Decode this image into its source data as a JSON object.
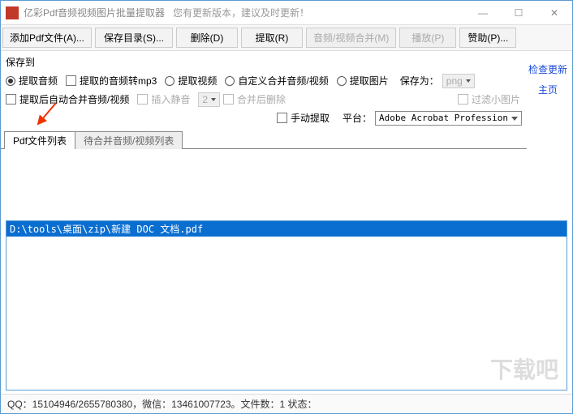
{
  "title": "亿彩Pdf音频视频图片批量提取器",
  "title_sub": "您有更新版本，建议及时更新！",
  "win": {
    "min": "—",
    "max": "☐",
    "close": "✕"
  },
  "toolbar": {
    "add": "添加Pdf文件(A)...",
    "save": "保存目录(S)...",
    "del": "删除(D)",
    "extract": "提取(R)",
    "merge": "音频/视频合并(M)",
    "play": "播放(P)",
    "sponsor": "赞助(P)..."
  },
  "opts": {
    "save_to": "保存到",
    "r_audio": "提取音频",
    "c_mp3": "提取的音频转mp3",
    "r_video": "提取视频",
    "r_custom": "自定义合并音频/视频",
    "r_image": "提取图片",
    "saveas": "保存为：",
    "saveas_val": "png",
    "c_automerge": "提取后自动合并音频/视频",
    "c_silence": "插入静音",
    "silence_val": "2",
    "c_delafter": "合并后删除",
    "c_manual": "手动提取",
    "platform": "平台：",
    "platform_val": "Adobe Acrobat Profession",
    "c_filtersmall": "过滤小图片"
  },
  "links": {
    "update": "检查更新",
    "home": "主页"
  },
  "tabs": {
    "t1": "Pdf文件列表",
    "t2": "待合并音频/视频列表"
  },
  "list": {
    "item0": "D:\\tools\\桌面\\zip\\新建 DOC 文档.pdf"
  },
  "status": "QQ：15104946/2655780380，微信：13461007723。文件数：1  状态："
}
